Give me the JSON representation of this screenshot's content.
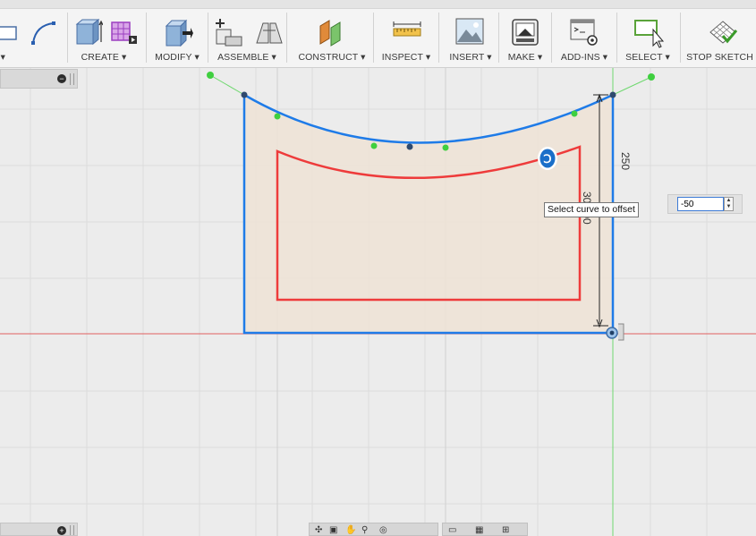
{
  "toolbar": {
    "create_label": "CREATE",
    "modify_label": "MODIFY",
    "assemble_label": "ASSEMBLE",
    "construct_label": "CONSTRUCT",
    "inspect_label": "INSPECT",
    "insert_label": "INSERT",
    "make_label": "MAKE",
    "addins_label": "ADD-INS",
    "select_label": "SELECT",
    "stop_sketch_label": "STOP SKETCH",
    "dropdown_glyph": "▾"
  },
  "browser": {
    "collapse_glyph": "−",
    "expand_glyph": "+"
  },
  "sketch": {
    "dimension_height": "250",
    "dimension_offset": "300.00",
    "offset_icon_glyph": "Ↄ"
  },
  "tooltip": {
    "text": "Select curve to offset"
  },
  "offset_input": {
    "value": "-50"
  },
  "colors": {
    "profile_fill": "#efe3d6",
    "selected_curve": "#1e7be8",
    "offset_curve": "#ee3b3b",
    "constraint_point": "#3fcf3f",
    "axis_red": "#e06060",
    "axis_green": "#6fd86f",
    "grid": "#dcdcdc"
  }
}
